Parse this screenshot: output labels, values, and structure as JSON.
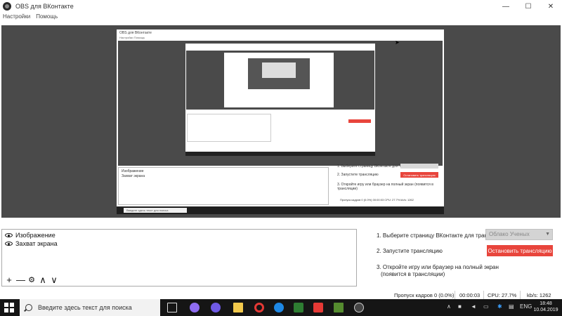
{
  "window": {
    "title": "OBS для ВКонтакте",
    "minimize_glyph": "—",
    "maximize_glyph": "☐",
    "close_glyph": "✕"
  },
  "menu": [
    "Настройки",
    "Помощь"
  ],
  "sources": {
    "items": [
      {
        "label": "Изображение",
        "icon": "eye-icon"
      },
      {
        "label": "Захват экрана",
        "icon": "eye-icon"
      }
    ],
    "toolbar": {
      "add": "+",
      "remove": "—",
      "settings": "⚙",
      "up": "∧",
      "down": "∨"
    }
  },
  "controls": {
    "step1": "1. Выберите страницу ВКонтакте для трансляции",
    "page_select_value": "Облако Ученых",
    "step2": "2. Запустите трансляцию",
    "stop_button": "Остановить трансляцию",
    "step3_line1": "3. Откройте игру или браузер на полный экран",
    "step3_line2": "(появится в трансляции)"
  },
  "status": {
    "dropped_frames": "Пропуск кадров 0 (0.0%)",
    "time": "00:00:03",
    "cpu": "CPU: 27.7%",
    "kbps": "kb/s: 1262"
  },
  "nested_preview": {
    "title": "OBS для ВКонтакте",
    "menu": "Настройки    Помощь",
    "source1": "Изображение",
    "source2": "Захват экрана",
    "step1": "1. Выберите страницу ВКонтакте для трансляции",
    "step2": "2. Запустите трансляцию",
    "stop": "Остановить трансляцию",
    "step3": "3. Откройте игру или браузер на полный экран (появится в трансляции)",
    "status": "Пропуск кадров 0 (0.0%)      00:00:03      CPU: 27.7%      kb/s: 1262",
    "taskbar_search": "Введите здесь текст для поиска"
  },
  "taskbar": {
    "search_placeholder": "Введите здесь текст для поиска",
    "language": "ENG",
    "time": "18:48",
    "date": "10.04.2019",
    "icons": [
      "task-view-icon",
      "alice-icon",
      "microphone-icon",
      "file-explorer-icon",
      "opera-icon",
      "edge-icon",
      "game-icon",
      "red-app-icon",
      "minecraft-icon",
      "obs-icon"
    ],
    "colors": {
      "taskbar": "#151515",
      "accent_red": "#e8453c"
    }
  }
}
